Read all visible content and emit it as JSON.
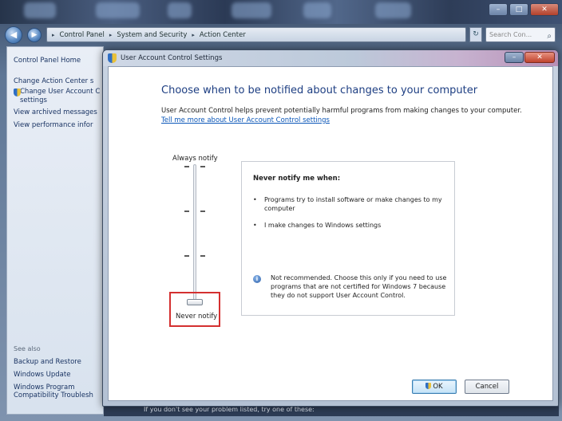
{
  "background_window": {
    "breadcrumb": [
      "Control Panel",
      "System and Security",
      "Action Center"
    ],
    "search_placeholder": "Search Con...",
    "sidebar": {
      "items": [
        {
          "label": "Control Panel Home"
        },
        {
          "label": "Change Action Center s"
        },
        {
          "label": "Change User Account C"
        },
        {
          "label": "settings"
        },
        {
          "label": "View archived messages"
        },
        {
          "label": "View performance infor"
        }
      ],
      "see_also_header": "See also",
      "see_also": [
        {
          "label": "Backup and Restore"
        },
        {
          "label": "Windows Update"
        },
        {
          "label": "Windows Program"
        },
        {
          "label": "Compatibility Troublesh"
        }
      ]
    },
    "status_text": "If you don't see your problem listed, try one of these:"
  },
  "dialog": {
    "title": "User Account Control Settings",
    "heading": "Choose when to be notified about changes to your computer",
    "intro": "User Account Control helps prevent potentially harmful programs from making changes to your computer.",
    "learn_link": "Tell me more about User Account Control settings",
    "slider": {
      "top_label": "Always notify",
      "bottom_label": "Never notify",
      "position": 0,
      "levels": 4
    },
    "info": {
      "title": "Never notify me when:",
      "bullets": [
        "Programs try to install software or make changes to my computer",
        "I make changes to Windows settings"
      ],
      "note": "Not recommended. Choose this only if you need to use programs that are not certified for Windows 7 because they do not support User Account Control."
    },
    "buttons": {
      "ok": "OK",
      "cancel": "Cancel"
    }
  }
}
